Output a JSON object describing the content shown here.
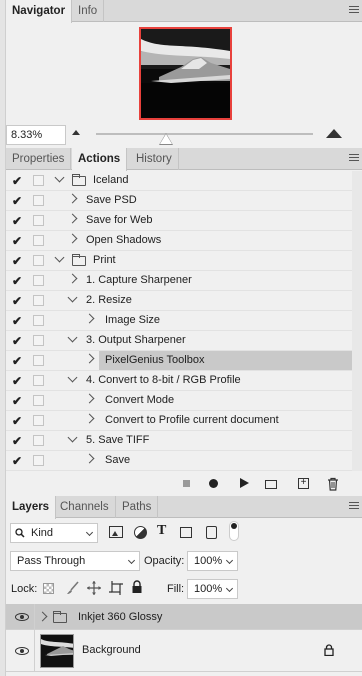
{
  "navigator": {
    "tabs": [
      "Navigator",
      "Info"
    ],
    "zoom": "8.33%",
    "zoom_slider_value": 0.33
  },
  "actions_panel": {
    "tabs": [
      "Properties",
      "Actions",
      "History"
    ],
    "rows": [
      {
        "label": "Iceland",
        "type": "set",
        "expanded": true
      },
      {
        "label": "Save PSD",
        "type": "action",
        "expanded": false
      },
      {
        "label": "Save for Web",
        "type": "action",
        "expanded": false
      },
      {
        "label": "Open Shadows",
        "type": "action",
        "expanded": false
      },
      {
        "label": "Print",
        "type": "set",
        "expanded": true
      },
      {
        "label": "1. Capture Sharpener",
        "type": "action",
        "expanded": false
      },
      {
        "label": "2. Resize",
        "type": "action",
        "expanded": true
      },
      {
        "label": "Image Size",
        "type": "command"
      },
      {
        "label": "3. Output Sharpener",
        "type": "action",
        "expanded": true
      },
      {
        "label": "PixelGenius Toolbox",
        "type": "command",
        "selected": true
      },
      {
        "label": "4. Convert to 8-bit / RGB Profile",
        "type": "action",
        "expanded": true
      },
      {
        "label": "Convert Mode",
        "type": "command"
      },
      {
        "label": "Convert to Profile current document",
        "type": "command"
      },
      {
        "label": "5. Save TIFF",
        "type": "action",
        "expanded": true
      },
      {
        "label": "Save",
        "type": "command"
      }
    ],
    "toolbar_icons": [
      "stop-icon",
      "record-icon",
      "play-icon",
      "new-set-icon",
      "new-action-icon",
      "delete-icon"
    ]
  },
  "layers_panel": {
    "tabs": [
      "Layers",
      "Channels",
      "Paths"
    ],
    "filter_kind": "Kind",
    "blend_mode": "Pass Through",
    "opacity_label": "Opacity:",
    "opacity": "100%",
    "lock_label": "Lock:",
    "fill_label": "Fill:",
    "fill": "100%",
    "layers": [
      {
        "name": "Inkjet 360 Glossy",
        "type": "group",
        "selected": true
      },
      {
        "name": "Background",
        "type": "pixel",
        "locked": true
      }
    ]
  },
  "colors": {
    "navigator_frame": "#e8413c",
    "selected_row": "#c9c9c9",
    "panel_bg": "#f0f0f0"
  }
}
